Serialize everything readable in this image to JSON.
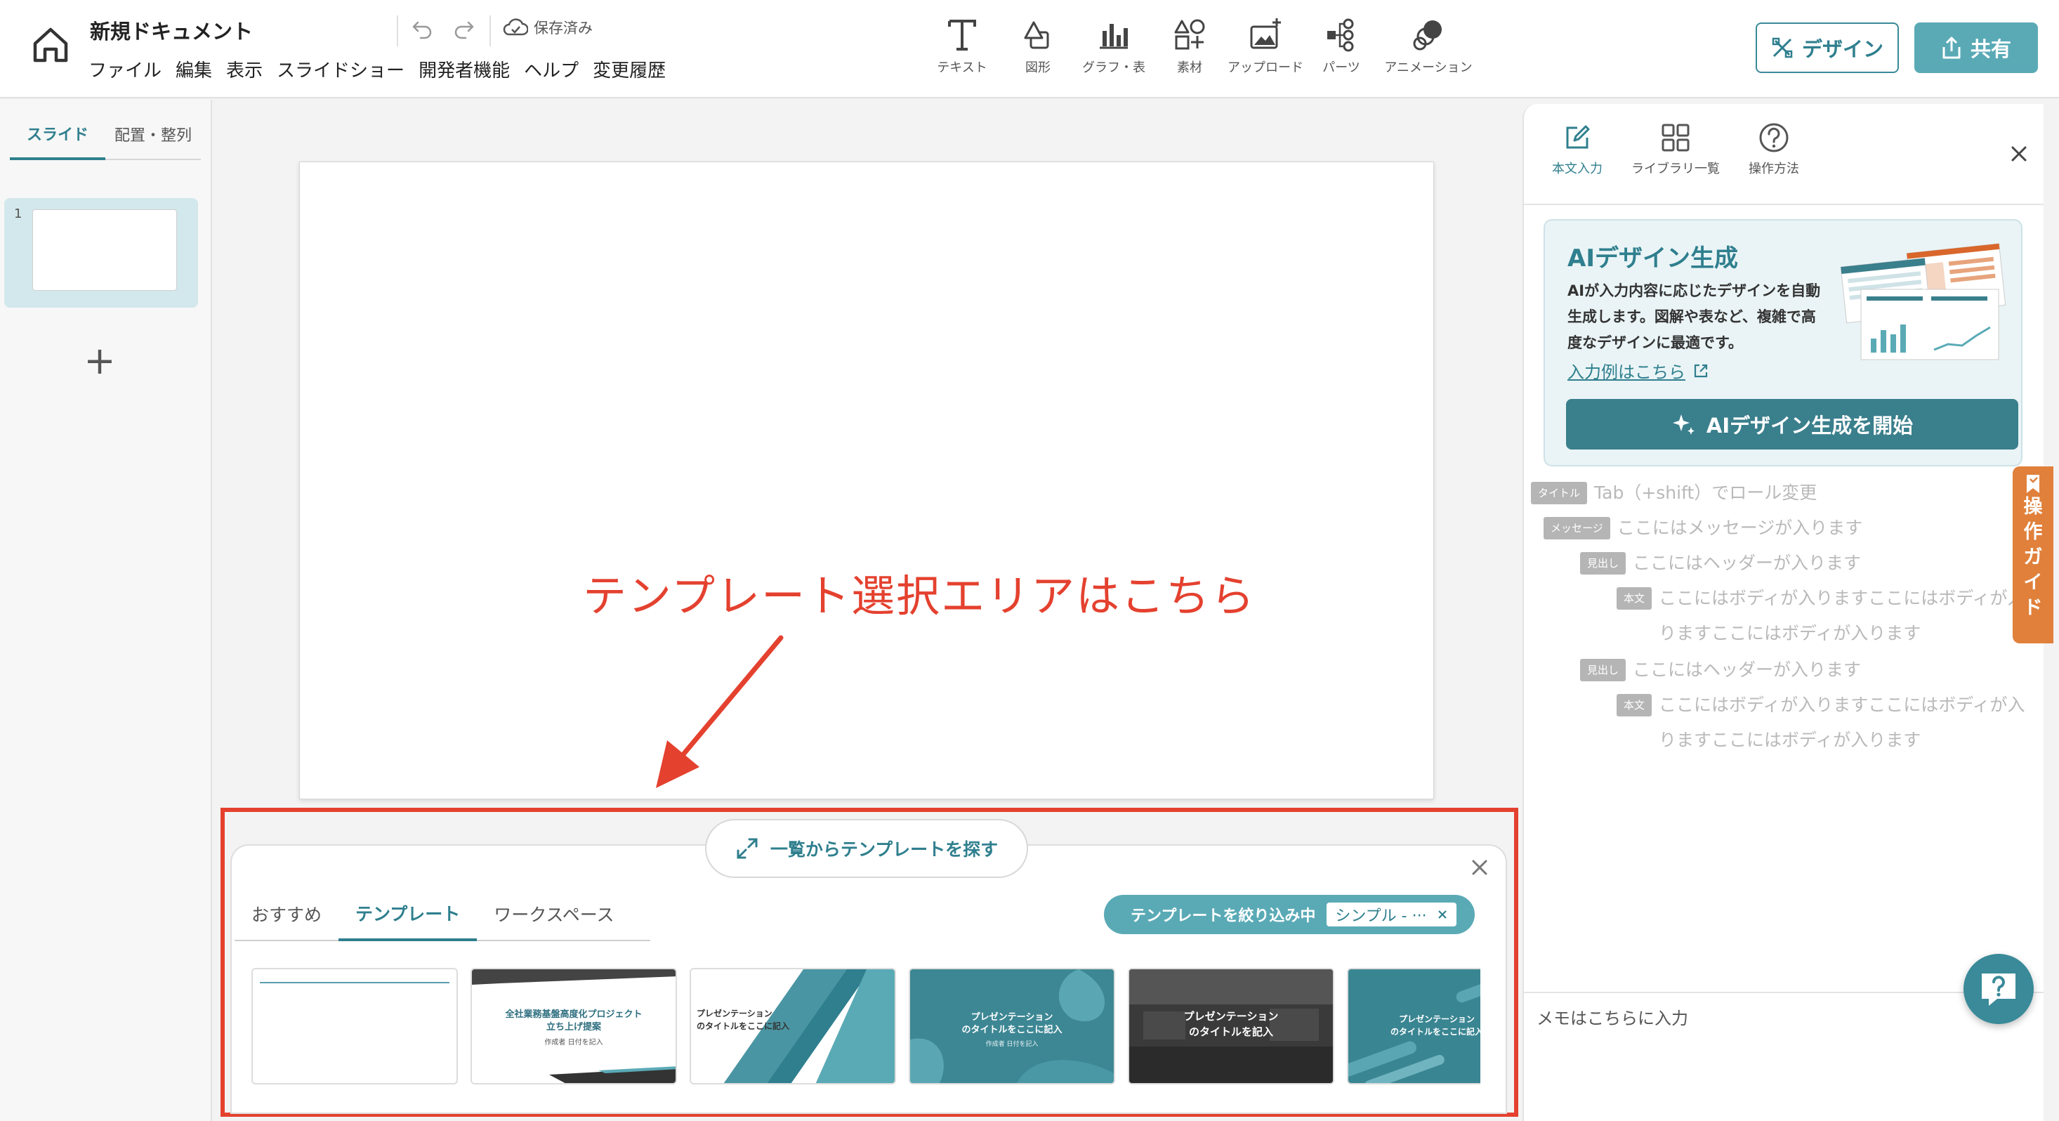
{
  "header": {
    "doc_title": "新規ドキュメント",
    "menu": [
      "ファイル",
      "編集",
      "表示",
      "スライドショー",
      "開発者機能",
      "ヘルプ",
      "変更履歴"
    ],
    "saved_label": "保存済み",
    "tools": [
      {
        "label": "テキスト",
        "icon": "text-icon"
      },
      {
        "label": "図形",
        "icon": "shape-icon"
      },
      {
        "label": "グラフ・表",
        "icon": "chart-icon"
      },
      {
        "label": "素材",
        "icon": "material-icon"
      },
      {
        "label": "アップロード",
        "icon": "upload-icon"
      },
      {
        "label": "パーツ",
        "icon": "parts-icon"
      },
      {
        "label": "アニメーション",
        "icon": "animation-icon"
      }
    ],
    "design_label": "デザイン",
    "share_label": "共有"
  },
  "left_sidebar": {
    "tabs": [
      "スライド",
      "配置・整列"
    ],
    "active_tab": "スライド",
    "slides": [
      {
        "number": "1"
      }
    ],
    "add_label": "+"
  },
  "canvas": {
    "callout": "テンプレート選択エリアはこちら"
  },
  "template_panel": {
    "browse_label": "一覧からテンプレートを探す",
    "tabs": [
      "おすすめ",
      "テンプレート",
      "ワークスペース"
    ],
    "active_tab": "テンプレート",
    "filter_label": "テンプレートを絞り込み中",
    "filter_tag": "シンプル - ···",
    "templates": [
      {
        "title": ""
      },
      {
        "title": "全社業務基盤高度化プロジェクト\n立ち上げ提案",
        "sub": "作成者 日付を記入"
      },
      {
        "title": "プレゼンテーション\nのタイトルをここに記入"
      },
      {
        "title": "プレゼンテーション\nのタイトルをここに記入",
        "sub": "作成者 日付を記入"
      },
      {
        "title": "プレゼンテーション\nのタイトルを記入"
      },
      {
        "title": "プレゼンテーション\nのタイトルをここに記入"
      }
    ]
  },
  "right_panel": {
    "tabs": [
      {
        "label": "本文入力",
        "icon": "edit-icon"
      },
      {
        "label": "ライブラリ一覧",
        "icon": "grid-icon"
      },
      {
        "label": "操作方法",
        "icon": "question-icon"
      }
    ],
    "active_tab": "本文入力",
    "ai": {
      "title": "AIデザイン生成",
      "description": "AIが入力内容に応じたデザインを自動生成します。図解や表など、複雑で高度なデザインに最適です。",
      "link": "入力例はこちら",
      "button": "AIデザイン生成を開始"
    },
    "outline": [
      {
        "badge": "タイトル",
        "text": "Tab（+shift）でロール変更"
      },
      {
        "badge": "メッセージ",
        "text": "ここにはメッセージが入ります"
      },
      {
        "badge": "見出し",
        "text": "ここにはヘッダーが入ります"
      },
      {
        "badge": "本文",
        "text": "ここにはボディが入りますここにはボディが入",
        "text2": "りますここにはボディが入ります"
      },
      {
        "badge": "見出し",
        "text": "ここにはヘッダーが入ります"
      },
      {
        "badge": "本文",
        "text": "ここにはボディが入りますここにはボディが入",
        "text2": "りますここにはボディが入ります"
      }
    ],
    "guide_label": "操作ガイド",
    "memo_placeholder": "メモはこちらに入力"
  },
  "colors": {
    "accent": "#2f7f8e",
    "accent_light": "#5aaab6",
    "callout": "#e4412f",
    "guide": "#e0803b"
  }
}
